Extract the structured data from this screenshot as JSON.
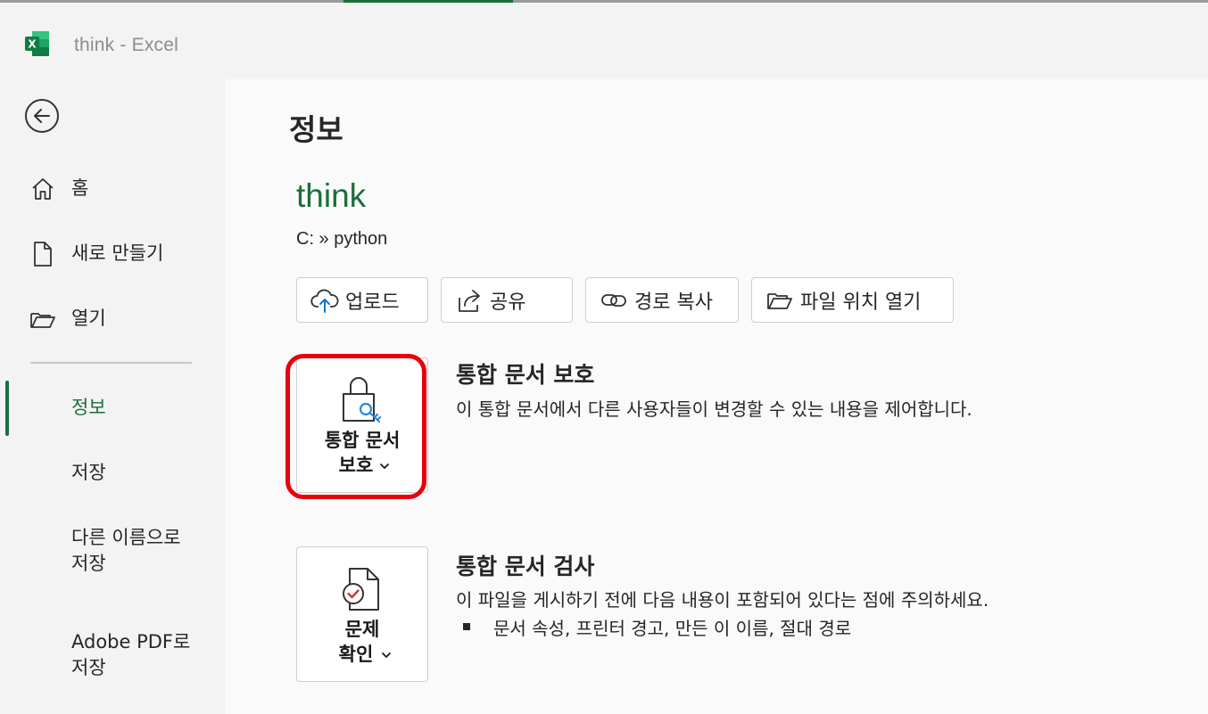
{
  "window": {
    "title": "think  -  Excel"
  },
  "sidebar": {
    "items": [
      {
        "label": "홈"
      },
      {
        "label": "새로 만들기"
      },
      {
        "label": "열기"
      },
      {
        "label": "정보"
      },
      {
        "label": "저장"
      },
      {
        "label": "다른 이름으로 저장",
        "line1": "다른 이름으로",
        "line2": "저장"
      },
      {
        "label": "Adobe PDF로 저장",
        "line1": "Adobe PDF로",
        "line2": "저장"
      }
    ],
    "active": "정보"
  },
  "main": {
    "heading": "정보",
    "doc_name": "think",
    "doc_path": "C: » python",
    "actions": [
      {
        "label": "업로드",
        "icon": "cloud-upload-icon"
      },
      {
        "label": "공유",
        "icon": "share-icon"
      },
      {
        "label": "경로 복사",
        "icon": "link-icon"
      },
      {
        "label": "파일 위치 열기",
        "icon": "folder-open-icon"
      }
    ],
    "protect": {
      "tile_line1": "통합 문서",
      "tile_line2": "보호",
      "title": "통합 문서 보호",
      "description": "이 통합 문서에서 다른 사용자들이 변경할 수 있는 내용을 제어합니다."
    },
    "inspect": {
      "tile_line1": "문제",
      "tile_line2": "확인",
      "title": "통합 문서 검사",
      "description": "이 파일을 게시하기 전에 다음 내용이 포함되어 있다는 점에 주의하세요.",
      "bullets": [
        "문서 속성, 프린터 경고, 만든 이 이름, 절대 경로"
      ]
    }
  },
  "colors": {
    "accent": "#1b6e3c",
    "highlight": "#e8000b",
    "upload_arrow": "#1a73c9"
  }
}
